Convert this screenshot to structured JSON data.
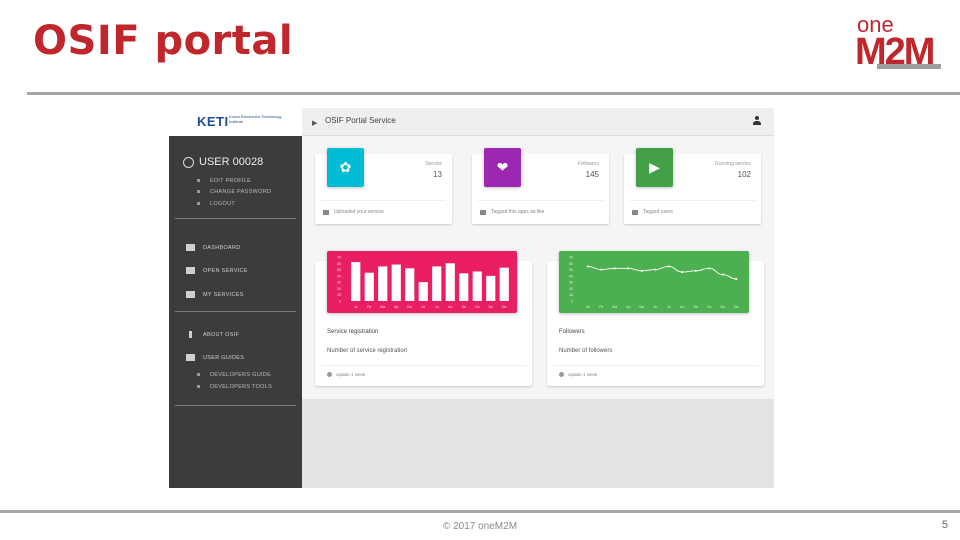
{
  "slide": {
    "title": "OSIF portal",
    "logo_one": "one",
    "logo_m2m": "M2M",
    "footer": "© 2017 oneM2M",
    "page_number": "5",
    "brand_color": "#c0272d"
  },
  "app": {
    "sidebar": {
      "logo_text": "KETI",
      "logo_subtext": "Korea Electronics Technology Institute",
      "user_label": "USER 00028",
      "user_menu": [
        "EDIT PROFILE",
        "CHANGE PASSWORD",
        "LOGOUT"
      ],
      "nav": [
        {
          "label": "DASHBOARD",
          "icon": "dashboard-icon"
        },
        {
          "label": "OPEN SERVICE",
          "icon": "open-service-icon"
        },
        {
          "label": "MY SERVICES",
          "icon": "my-services-icon"
        },
        {
          "label": "ABOUT OSIF",
          "icon": "info-icon"
        },
        {
          "label": "USER GUIDES",
          "icon": "user-guides-icon"
        }
      ],
      "guides": [
        "DEVELOPERS GUIDE",
        "DEVELOPERS TOOLS"
      ]
    },
    "topbar": {
      "title": "OSIF Portal Service",
      "menu_icon": "hamburger-icon",
      "user_icon": "user-icon"
    },
    "stats": [
      {
        "label": "Service",
        "value": "13",
        "footer": "Uploaded your service",
        "color": "#00bcd4",
        "icon": "apps-icon"
      },
      {
        "label": "Followers",
        "value": "145",
        "footer": "Tagged this apps as like",
        "color": "#9c27b0",
        "icon": "heart-icon"
      },
      {
        "label": "Running service",
        "value": "102",
        "footer": "Tagged users",
        "color": "#43a047",
        "icon": "play-icon"
      }
    ],
    "cards": [
      {
        "title": "Service registration",
        "subtitle": "Number of service registration",
        "footer": "update 1 week",
        "color": "#e91e63",
        "chart_type": "bar"
      },
      {
        "title": "Followers",
        "subtitle": "Number of followers",
        "footer": "update 1 week",
        "color": "#4caf50",
        "chart_type": "line"
      }
    ]
  },
  "chart_data": [
    {
      "type": "bar",
      "categories": [
        "Ja",
        "Fe",
        "Ma",
        "Ap",
        "Ma",
        "Ju",
        "Ju",
        "Au",
        "Se",
        "Oc",
        "No",
        "De"
      ],
      "values": [
        62,
        45,
        55,
        58,
        52,
        30,
        55,
        60,
        44,
        47,
        40,
        53
      ],
      "ylim": [
        0,
        70
      ],
      "yticks": [
        0,
        10,
        20,
        30,
        40,
        50,
        60,
        70
      ]
    },
    {
      "type": "line",
      "categories": [
        "Ja",
        "Fe",
        "Ma",
        "Ap",
        "Ma",
        "Ju",
        "Ju",
        "Au",
        "Se",
        "Oc",
        "No",
        "De"
      ],
      "values": [
        55,
        50,
        52,
        52,
        48,
        50,
        55,
        46,
        48,
        52,
        42,
        35
      ],
      "ylim": [
        0,
        70
      ],
      "yticks": [
        0,
        10,
        20,
        30,
        40,
        50,
        60,
        70
      ]
    }
  ]
}
